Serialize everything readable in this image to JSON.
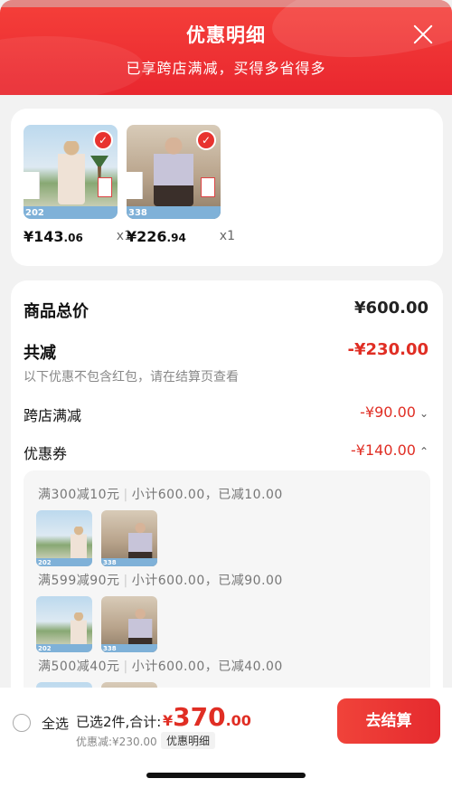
{
  "header": {
    "title": "优惠明细",
    "subtitle": "已享跨店满减，买得多省得多"
  },
  "products": [
    {
      "badge": "202",
      "price_main": "¥143",
      "price_decimal": ".06",
      "qty": "x1"
    },
    {
      "badge": "338",
      "price_main": "¥226",
      "price_decimal": ".94",
      "qty": "x1"
    }
  ],
  "summary": {
    "total_label": "商品总价",
    "total_value": "¥600.00",
    "reduce_label": "共减",
    "reduce_value": "-¥230.00",
    "note": "以下优惠不包含红包，请在结算页查看",
    "cross_store_label": "跨店满减",
    "cross_store_value": "-¥90.00",
    "coupon_label": "优惠券",
    "coupon_value": "-¥140.00"
  },
  "coupons": [
    {
      "rule": "满300减10元",
      "detail": "小计600.00，已减10.00"
    },
    {
      "rule": "满599减90元",
      "detail": "小计600.00，已减90.00"
    },
    {
      "rule": "满500减40元",
      "detail": "小计600.00，已减40.00"
    }
  ],
  "footer": {
    "select_all": "全选",
    "selected_text": "已选2件,合计:",
    "total_yen": "¥",
    "total_int": "370",
    "total_dec": ".00",
    "discount_text": "优惠减:¥230.00",
    "detail_link": "优惠明细",
    "checkout": "去结算"
  },
  "colors": {
    "accent": "#e8332f",
    "price_red": "#e02e24"
  }
}
